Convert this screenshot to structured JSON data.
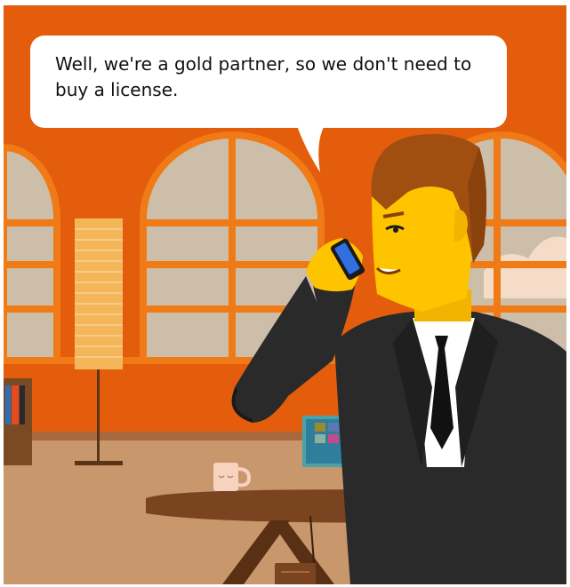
{
  "speech_bubble": {
    "text": "Well, we're a gold partner, so we don't need to buy a license."
  },
  "colors": {
    "wall": "#e35d0c",
    "window_glass": "#cdbeaa",
    "window_frame": "#f07a16",
    "floor": "#c8976c",
    "table": "#7a4420",
    "suit": "#2a2a2a",
    "skin": "#ffc400",
    "hair": "#a14f11",
    "phone": "#2f6fe0",
    "bubble": "#ffffff"
  },
  "icons": [
    "phone-icon",
    "coffee-mug-icon"
  ]
}
